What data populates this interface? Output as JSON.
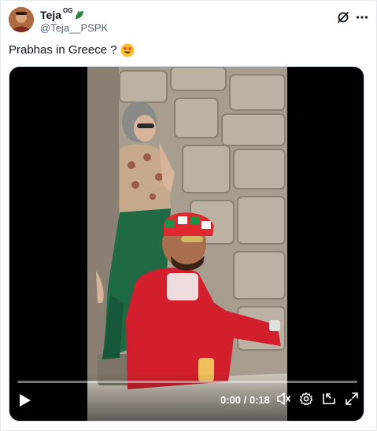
{
  "post": {
    "display_name": "Teja",
    "name_suffix": "OG",
    "handle": "@Teja__PSPK",
    "text": "Prabhas in Greece ?",
    "emoji": "smiling-face-with-heart-eyes"
  },
  "header_icons": [
    "grok-icon",
    "more-options-icon"
  ],
  "video": {
    "current_time": "0:00",
    "separator": " / ",
    "duration": "0:18",
    "progress": 0.0,
    "controls": [
      "play-icon",
      "volume-icon",
      "settings-icon",
      "picture-in-picture-icon",
      "fullscreen-icon"
    ]
  },
  "colors": {
    "text_primary": "#0f1419",
    "text_secondary": "#536471",
    "border": "#cfd9de",
    "leaf_emoji": "#2f8f4a"
  }
}
